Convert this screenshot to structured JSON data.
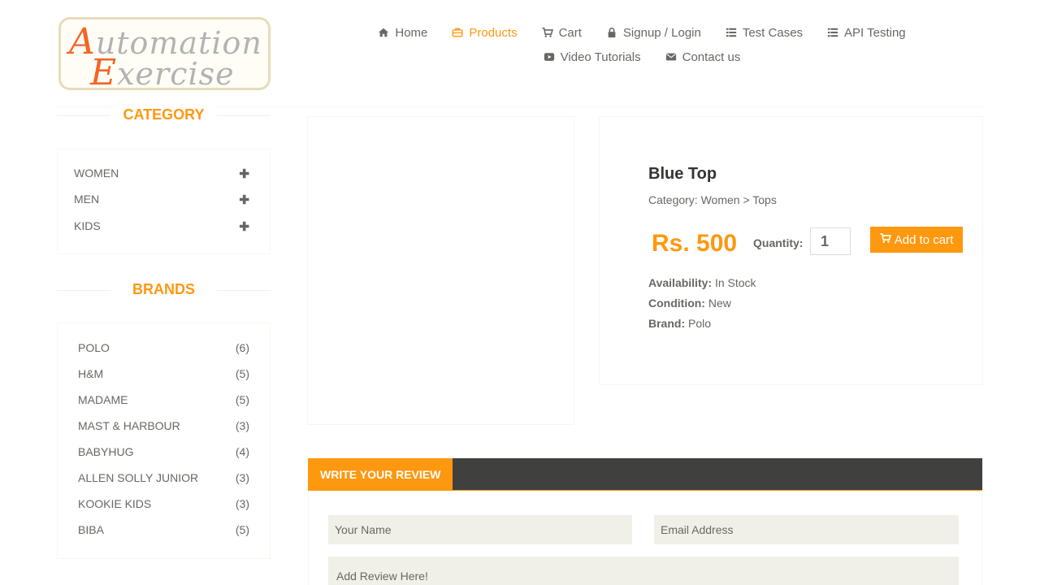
{
  "brand": {
    "logo_line1": "Automation",
    "logo_line2": "Exercise",
    "logo_cap1": "A",
    "logo_cap2": "E"
  },
  "nav": [
    {
      "label": "Home",
      "icon": "home-icon",
      "active": false
    },
    {
      "label": "Products",
      "icon": "products-icon",
      "active": true
    },
    {
      "label": "Cart",
      "icon": "cart-icon",
      "active": false
    },
    {
      "label": "Signup / Login",
      "icon": "lock-icon",
      "active": false
    },
    {
      "label": "Test Cases",
      "icon": "list-icon",
      "active": false
    },
    {
      "label": "API Testing",
      "icon": "list-icon",
      "active": false
    },
    {
      "label": "Video Tutorials",
      "icon": "youtube-icon",
      "active": false
    },
    {
      "label": "Contact us",
      "icon": "envelope-icon",
      "active": false
    }
  ],
  "sidebar": {
    "category_title": "CATEGORY",
    "categories": [
      "WOMEN",
      "MEN",
      "KIDS"
    ],
    "brands_title": "BRANDS",
    "brands": [
      {
        "name": "POLO",
        "count": "(6)"
      },
      {
        "name": "H&M",
        "count": "(5)"
      },
      {
        "name": "MADAME",
        "count": "(5)"
      },
      {
        "name": "MAST & HARBOUR",
        "count": "(3)"
      },
      {
        "name": "BABYHUG",
        "count": "(4)"
      },
      {
        "name": "ALLEN SOLLY JUNIOR",
        "count": "(3)"
      },
      {
        "name": "KOOKIE KIDS",
        "count": "(3)"
      },
      {
        "name": "BIBA",
        "count": "(5)"
      }
    ]
  },
  "product": {
    "name": "Blue Top",
    "category": "Category: Women > Tops",
    "price": "Rs. 500",
    "quantity_label": "Quantity:",
    "quantity_value": "1",
    "add_to_cart": "Add to cart",
    "availability_label": "Availability:",
    "availability": "In Stock",
    "condition_label": "Condition:",
    "condition": "New",
    "brand_label": "Brand:",
    "brand": "Polo"
  },
  "review": {
    "tab_label": "WRITE YOUR REVIEW",
    "name_placeholder": "Your Name",
    "email_placeholder": "Email Address",
    "review_placeholder": "Add Review Here!"
  },
  "colors": {
    "accent": "#fe980f",
    "text": "#696763",
    "dark_bar": "#40403e",
    "input_bg": "#f0f0e9"
  }
}
